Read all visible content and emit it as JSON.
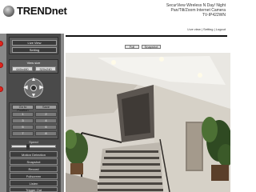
{
  "header": {
    "brand": "TRENDnet",
    "product_line1": "SecurView Wireless N Day/ Night",
    "product_line2": "Pan/Tilt/Zoom Internet Camera",
    "model": "TV-IP422WN",
    "nav": "Live view | Setting | Logout"
  },
  "left_panel": {
    "view_mode_buttons": [
      "Live View",
      "Setting"
    ],
    "view_size_label": "View size",
    "view_size_options": [
      "640x480",
      "320x240"
    ],
    "ptz_arrows": [
      "▲",
      "▼",
      "◀",
      "▶"
    ],
    "preset_headers": [
      "Go to Position",
      "Save"
    ],
    "preset_rows": [
      [
        "1",
        "2"
      ],
      [
        "3",
        "4"
      ],
      [
        "5",
        "6"
      ],
      [
        "7",
        "8"
      ]
    ],
    "speed_label": "Speed",
    "speed_level": 0.35,
    "actions": [
      "Motion Detection",
      "Snapshot",
      "Record",
      "Fullscreen",
      "Listen",
      "Trigger Out"
    ]
  },
  "video_toolbar": {
    "left_button": "Full",
    "right_button": "Snapshot"
  },
  "colors": {
    "panel": "#4a4a4a",
    "panel_border": "#8a8a8a",
    "marker": "#e0261c"
  }
}
